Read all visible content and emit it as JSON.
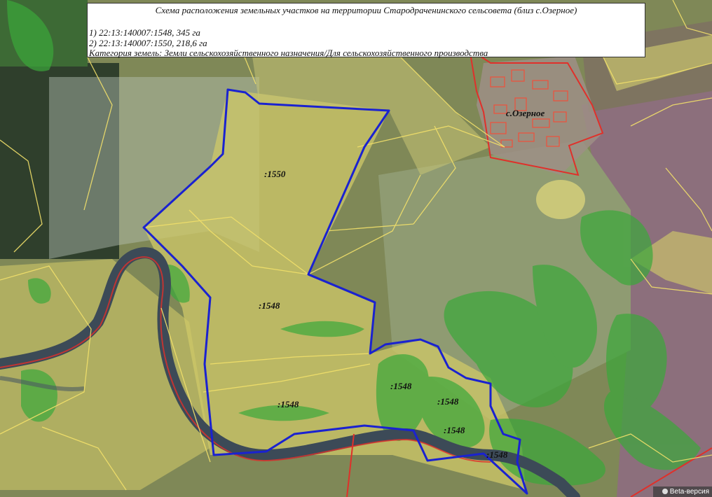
{
  "legend": {
    "title": "Схема расположения земельных участков на территории Стародрачeнинского сельсовета (близ с.Озерное)",
    "parcel_1": "1) 22:13:140007:1548, 345 га",
    "parcel_2": "2) 22:13:140007:1550, 218,6 га",
    "category": "Категория земель: Земли сельскохозяйственного назначения/Для сельскохозяйственного производства"
  },
  "labels": {
    "parcel_1550": ":1550",
    "parcel_1548_a": ":1548",
    "parcel_1548_b": ":1548",
    "parcel_1548_c": ":1548",
    "parcel_1548_d": ":1548",
    "parcel_1548_e": ":1548",
    "parcel_1548_f": ":1548",
    "village": "с.Озерное"
  },
  "badge": {
    "text": "Beta-версия"
  },
  "colors": {
    "parcel_outline": "#1a22d0",
    "cadastral_lines": "#f2e06a",
    "settlement_boundary": "#e0302a",
    "river": "#3a4a5c",
    "forest_overlay": "#3aa83a",
    "field_overlay": "#d9d36a"
  }
}
